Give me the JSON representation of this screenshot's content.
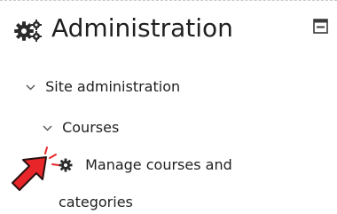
{
  "block": {
    "title": "Administration",
    "header_icon": "gears-icon",
    "collapse_icon": "collapse-minus-icon"
  },
  "tree": {
    "site_admin": {
      "label": "Site administration",
      "icon": "chevron-down-icon"
    },
    "courses": {
      "label": "Courses",
      "icon": "chevron-down-icon"
    },
    "manage": {
      "label_line1": "Manage courses and",
      "label_line2": "categories",
      "icon": "gear-icon"
    }
  },
  "annotation": {
    "icon": "pointer-arrow-icon",
    "color": "#e8262a"
  }
}
